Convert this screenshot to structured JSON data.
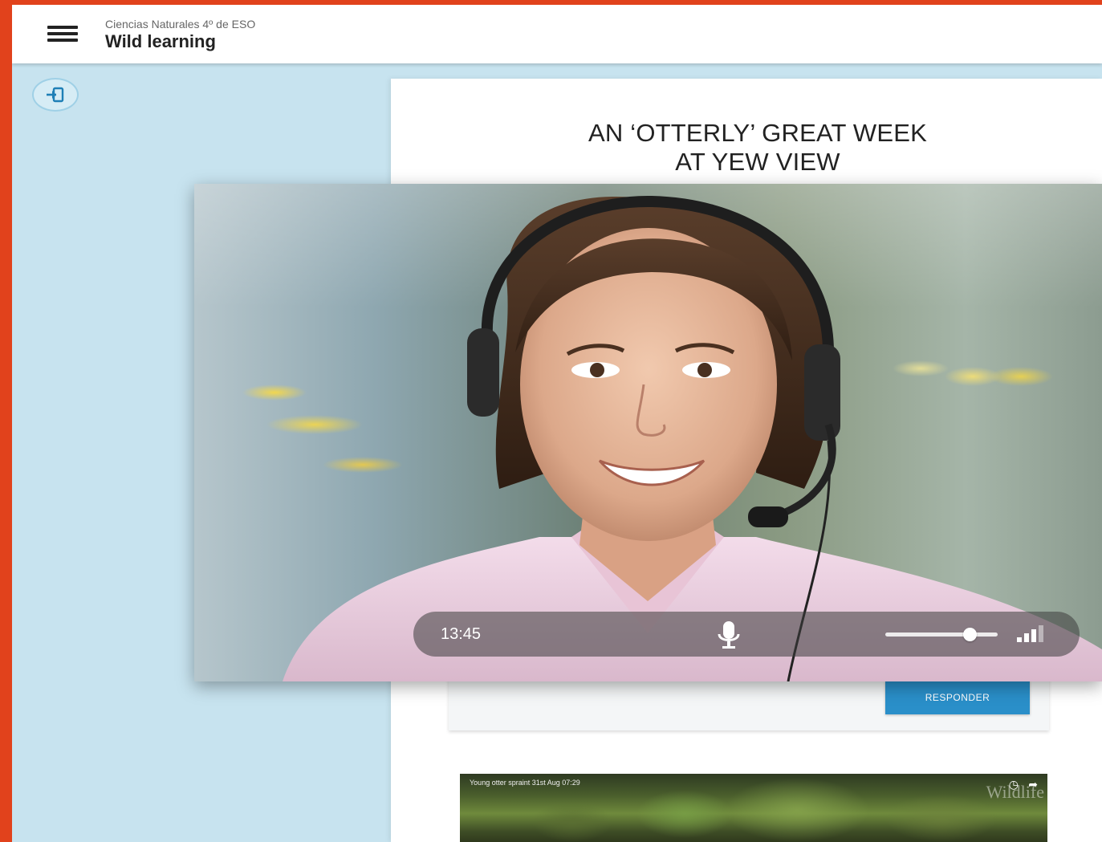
{
  "header": {
    "course": "Ciencias Naturales 4º de ESO",
    "title": "Wild learning"
  },
  "article": {
    "title_line1": "AN ‘OTTERLY’ GREAT WEEK",
    "title_line2": "AT YEW VIEW",
    "respond_label": "RESPONDER"
  },
  "video_thumbnail": {
    "caption": "Young otter spraint 31st Aug 07:29",
    "watermark": "Wildlife"
  },
  "video_call": {
    "time": "13:45",
    "volume_level": 0.75,
    "signal_strength": 0.75
  },
  "icons": {
    "menu": "hamburger-menu-icon",
    "exit": "exit-icon",
    "mic": "microphone-icon",
    "signal": "signal-strength-icon",
    "clock": "clock-icon",
    "share": "share-icon"
  },
  "colors": {
    "frame": "#e1421c",
    "background": "#c7e3ef",
    "button": "#2a8fc9"
  }
}
